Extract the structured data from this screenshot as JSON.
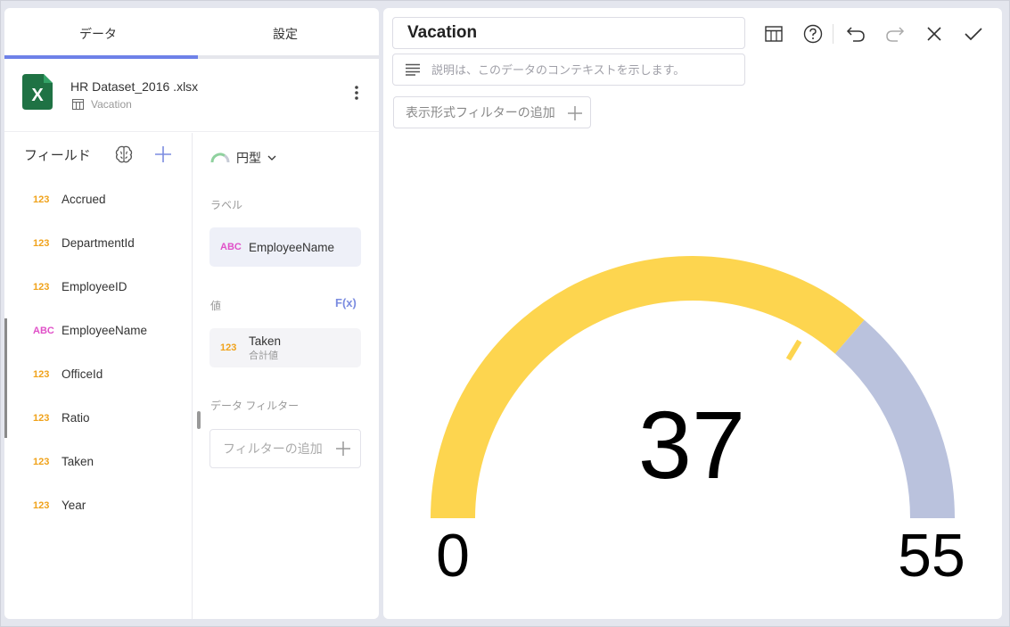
{
  "tabs": [
    {
      "label": "データ",
      "active": true
    },
    {
      "label": "設定",
      "active": false
    }
  ],
  "datasource": {
    "file_name": "HR Dataset_2016 .xlsx",
    "sheet_name": "Vacation"
  },
  "fields_panel": {
    "title": "フィールド",
    "items": [
      {
        "type": "123",
        "name": "Accrued"
      },
      {
        "type": "123",
        "name": "DepartmentId"
      },
      {
        "type": "123",
        "name": "EmployeeID"
      },
      {
        "type": "ABC",
        "name": "EmployeeName"
      },
      {
        "type": "123",
        "name": "OfficeId"
      },
      {
        "type": "123",
        "name": "Ratio"
      },
      {
        "type": "123",
        "name": "Taken"
      },
      {
        "type": "123",
        "name": "Year"
      }
    ]
  },
  "config": {
    "viz_type": "円型",
    "label_section": "ラベル",
    "label_field": {
      "type": "ABC",
      "name": "EmployeeName"
    },
    "value_section": "値",
    "fx_label": "F(x)",
    "value_field": {
      "type": "123",
      "name": "Taken",
      "aggregation": "合計値"
    },
    "filter_section": "データ フィルター",
    "filter_add_label": "フィルターの追加"
  },
  "editor": {
    "title_value": "Vacation",
    "description_placeholder": "説明は、このデータのコンテキストを示します。",
    "visual_filter_label": "表示形式フィルターの追加"
  },
  "toolbar": {
    "icons": [
      "table-icon",
      "help-icon",
      "undo-icon",
      "redo-icon",
      "close-icon",
      "check-icon"
    ]
  },
  "chart_data": {
    "type": "gauge",
    "value": 37,
    "min": 0,
    "max": 55,
    "band_boundary": 40,
    "marker": 37,
    "colors": {
      "primary_band": "#FDD54F",
      "secondary_band": "#BAC2DD"
    },
    "labels": {
      "value": "37",
      "min": "0",
      "max": "55"
    }
  },
  "colors": {
    "accent": "#6E81E8",
    "numeric_type": "#F0A21A",
    "text_type": "#E050C8",
    "excel_green": "#1F7244"
  }
}
